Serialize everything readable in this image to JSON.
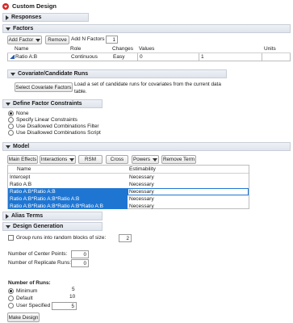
{
  "window": {
    "title": "Custom Design"
  },
  "sections": {
    "responses": "Responses",
    "factors": "Factors",
    "covariate": "Covariate/Candidate Runs",
    "constraints": "Define Factor Constraints",
    "model": "Model",
    "alias": "Alias Terms",
    "design_generation": "Design Generation"
  },
  "factors": {
    "add_factor_label": "Add Factor",
    "remove_label": "Remove",
    "add_n_label": "Add N Factors",
    "add_n_value": "1",
    "columns": [
      "Name",
      "Role",
      "Changes",
      "Values",
      "",
      "Units"
    ],
    "rows": [
      {
        "name": "Ratio A:B",
        "role": "Continuous",
        "changes": "Easy",
        "low": "0",
        "high": "1",
        "units": ""
      }
    ]
  },
  "covariate": {
    "button_label": "Select Covariate Factors",
    "description": "Load a set of candidate runs for covariates from the current data table."
  },
  "constraints": {
    "options": [
      {
        "label": "None",
        "selected": true
      },
      {
        "label": "Specify Linear Constraints",
        "selected": false
      },
      {
        "label": "Use Disallowed Combinations Filter",
        "selected": false
      },
      {
        "label": "Use Disallowed Combinations Script",
        "selected": false
      }
    ]
  },
  "model": {
    "buttons": {
      "main_effects": "Main Effects",
      "interactions": "Interactions",
      "rsm": "RSM",
      "cross": "Cross",
      "powers": "Powers",
      "remove_term": "Remove Term"
    },
    "columns": [
      "Name",
      "Estimability"
    ],
    "rows": [
      {
        "name": "Intercept",
        "estimability": "Necessary",
        "selected": false
      },
      {
        "name": "Ratio A:B",
        "estimability": "Necessary",
        "selected": false
      },
      {
        "name": "Ratio A:B*Ratio A:B",
        "estimability": "Necessary",
        "selected": true
      },
      {
        "name": "Ratio A:B*Ratio A:B*Ratio A:B",
        "estimability": "Necessary",
        "selected": true
      },
      {
        "name": "Ratio A:B*Ratio A:B*Ratio A:B*Ratio A:B",
        "estimability": "Necessary",
        "selected": true
      }
    ]
  },
  "design_generation": {
    "group_runs_label": "Group runs into random blocks of size:",
    "group_runs_value": "2",
    "center_points_label": "Number of Center Points:",
    "center_points_value": "0",
    "replicate_runs_label": "Number of Replicate Runs:",
    "replicate_runs_value": "0",
    "num_runs_heading": "Number of Runs:",
    "run_options": [
      {
        "label": "Minimum",
        "value": "5",
        "selected": true
      },
      {
        "label": "Default",
        "value": "10",
        "selected": false
      },
      {
        "label": "User Specified",
        "value": "5",
        "selected": false
      }
    ],
    "make_design_label": "Make Design"
  },
  "colors": {
    "selection": "#1f76d2",
    "header_gradient_top": "#eef1f6",
    "header_gradient_bottom": "#dfe4ec",
    "red_dropdown": "#d62a2a"
  }
}
